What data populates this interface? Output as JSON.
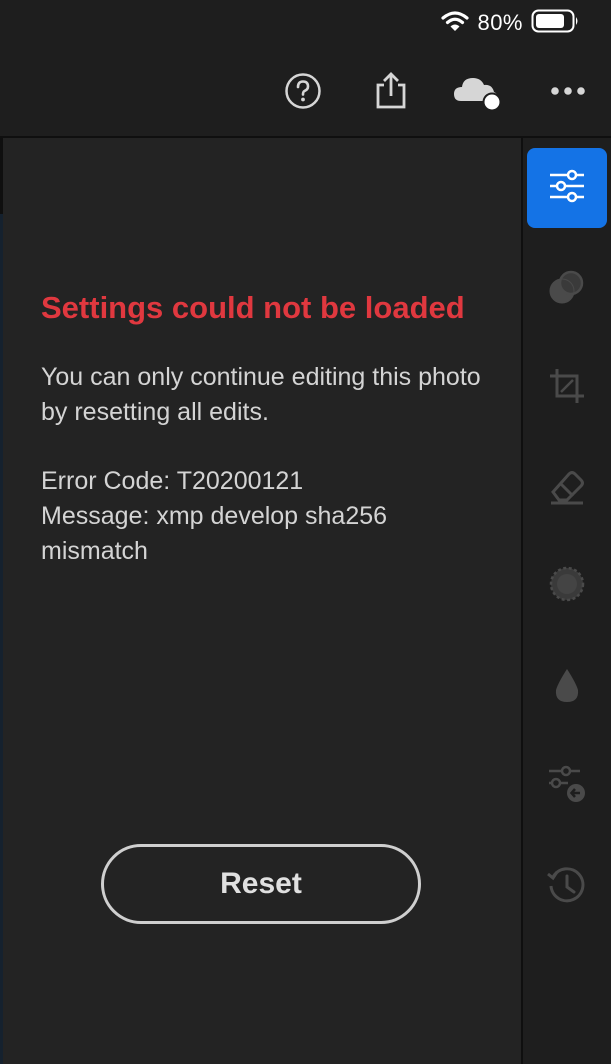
{
  "status_bar": {
    "battery_percent": "80%"
  },
  "toolbar": {
    "icons": [
      "help-icon",
      "share-icon",
      "cloud-sync-icon",
      "more-icon"
    ]
  },
  "error": {
    "title": "Settings could not be loaded",
    "description": "You can only continue editing this photo by resetting all edits.",
    "code_line": "Error Code: T20200121",
    "message_line": "Message: xmp develop sha256 mismatch"
  },
  "reset_button": {
    "label": "Reset"
  },
  "side_rail": {
    "tools": [
      "light-sliders-icon",
      "color-mix-icon",
      "crop-icon",
      "eraser-icon",
      "vignette-icon",
      "droplet-icon",
      "presets-apply-icon",
      "history-icon"
    ],
    "active_tool": "light-sliders-icon",
    "active_color": "#1473e6"
  },
  "colors": {
    "error_title": "#e0383f",
    "background": "#1e1e1e",
    "panel": "#232323"
  }
}
